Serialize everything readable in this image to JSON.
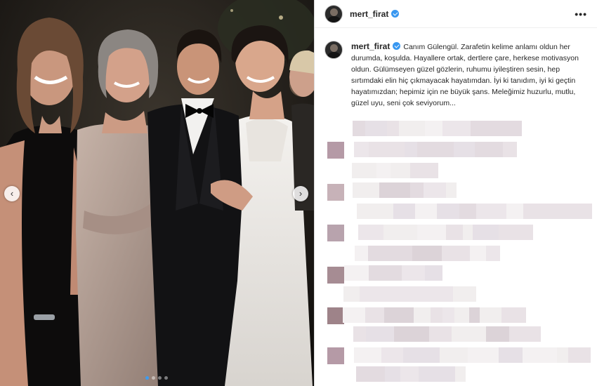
{
  "post": {
    "username": "mert_firat",
    "verified": true,
    "more_icon": "more-options-icon",
    "caption": "Canım Gülengül. Zarafetin kelime anlamı oldun her durumda, koşulda. Hayallere ortak, dertlere çare, herkese motivasyon oldun. Gülümseyen güzel gözlerin, ruhumu iyileştiren sesin, hep sırtımdaki elin hiç çıkmayacak hayatımdan. İyi ki tanıdım, iyi ki geçtin hayatımızdan; hepimiz için ne büyük şans. Meleğimiz huzurlu, mutlu, güzel uyu, seni çok seviyorum..."
  },
  "carousel": {
    "prev_icon": "chevron-left-icon",
    "next_icon": "chevron-right-icon",
    "prev_glyph": "‹",
    "next_glyph": "›",
    "dot_count": 4,
    "active_index": 0
  },
  "colors": {
    "verified": "#3897f0",
    "active_dot": "#3d9bf0"
  }
}
